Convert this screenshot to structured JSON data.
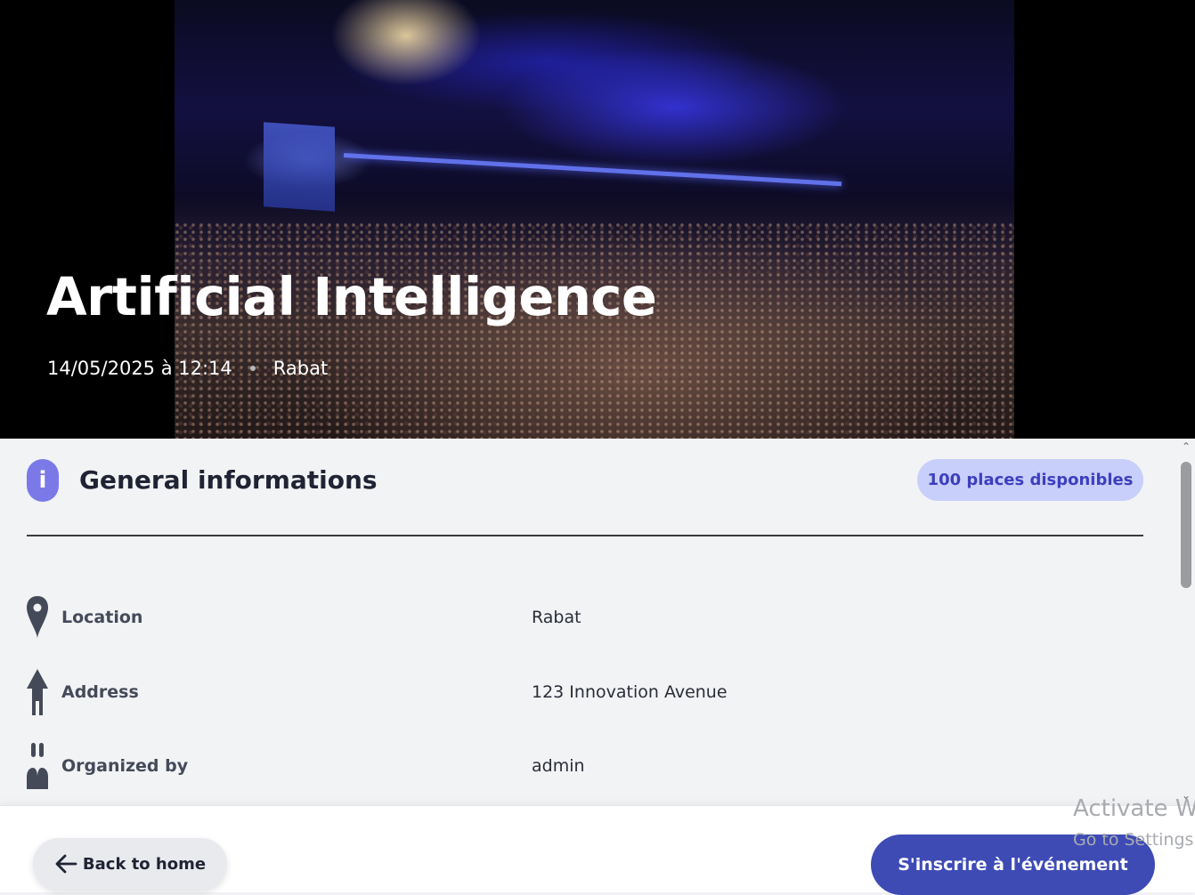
{
  "hero": {
    "title": "Artificial Intelligence",
    "datetime": "14/05/2025 à 12:14",
    "city": "Rabat"
  },
  "general": {
    "icon": "info-icon",
    "title": "General informations",
    "places_badge": "100 places disponibles",
    "accent_color": "#7b79e8",
    "badge_color": "#c9cffb",
    "rows": [
      {
        "icon": "map-pin-icon",
        "label": "Location",
        "value": "Rabat"
      },
      {
        "icon": "address-icon",
        "label": "Address",
        "value": "123 Innovation Avenue"
      },
      {
        "icon": "organizer-icon",
        "label": "Organized by",
        "value": "admin"
      }
    ]
  },
  "footer": {
    "back_label": "Back to home",
    "back_icon": "arrow-left-icon",
    "register_label": "S'inscrire à l'événement",
    "register_color": "#3e4bb5"
  },
  "watermark": {
    "line1": "Activate Windows",
    "line2": "Go to Settings to activate Windows."
  }
}
